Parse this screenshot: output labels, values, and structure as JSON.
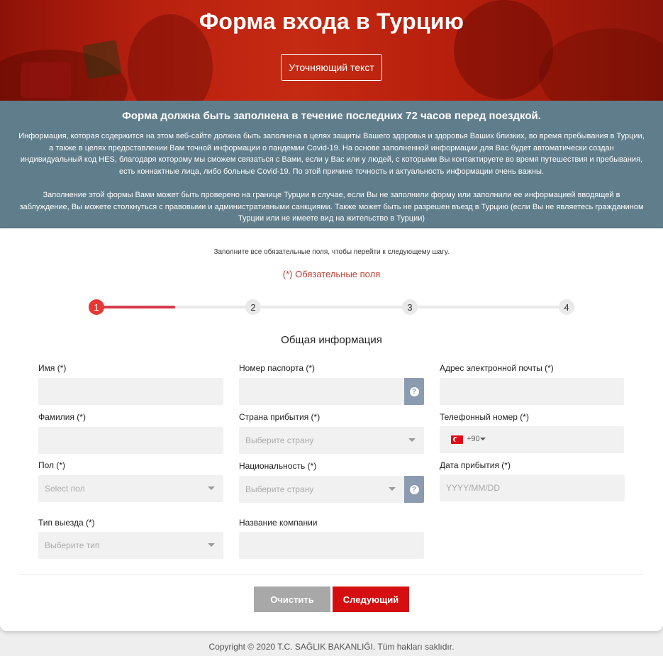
{
  "hero": {
    "title": "Форма входа в Турцию",
    "button_label": "Уточняющий текст"
  },
  "info": {
    "heading": "Форма должна быть заполнена в течение последних 72 часов перед поездкой.",
    "paragraph1": "Информация, которая содержится на этом веб-сайте должна быть заполнена в целях защиты Вашего здоровья и здоровья Ваших близких, во время пребывания в Турции, а также в целях предоставлении Вам точной информации о пандемии Covid-19. На основе заполненной информации для Вас будет автоматически создан индивидуальный код HES, благодаря которому мы сможем связаться с Вами, если у Вас или у людей, с которыми Вы контактируете во время путешествия и пребывания, есть коннактные лица, либо больные Covid-19. По этой причине точность и актуальность информации очень важны.",
    "paragraph2": "Заполнение этой формы Вами может быть проверено на границе Турции в случае, если Вы не заполнили форму или заполнили ее информацией вводящей в заблуждение, Вы можете столкнуться с правовыми и административными санкциями. Также может быть не разрешен въезд в Турцию (если Вы не являетесь гражданином Турции или не имеете вид на жительство в Турции)"
  },
  "form": {
    "instruction": "Заполните все обязательные поля, чтобы перейти к следующему шагу.",
    "required_note": "(*) Обязательные поля",
    "steps": [
      "1",
      "2",
      "3",
      "4"
    ],
    "active_step": 1,
    "section_title": "Общая информация",
    "fields": {
      "first_name": {
        "label": "Имя (*)",
        "value": ""
      },
      "last_name": {
        "label": "Фамилия (*)",
        "value": ""
      },
      "gender": {
        "label": "Пол (*)",
        "placeholder": "Select пол"
      },
      "exit_type": {
        "label": "Тип выезда (*)",
        "placeholder": "Выберите тип"
      },
      "passport": {
        "label": "Номер паспорта (*)",
        "value": ""
      },
      "arrival_country": {
        "label": "Страна прибытия (*)",
        "placeholder": "Выберите страну"
      },
      "nationality": {
        "label": "Национальность (*)",
        "placeholder": "Выберите страну"
      },
      "company": {
        "label": "Название компании",
        "value": ""
      },
      "email": {
        "label": "Адрес электронной почты (*)",
        "value": ""
      },
      "phone": {
        "label": "Телефонный номер (*)",
        "code": "+90"
      },
      "arrival_date": {
        "label": "Дата прибытия (*)",
        "placeholder": "YYYY/MM/DD"
      }
    },
    "help_symbol": "?",
    "buttons": {
      "clear": "Очистить",
      "next": "Следующий"
    }
  },
  "footer": {
    "copyright": "Copyright © 2020 T.C. SAĞLIK BAKANLIĞI. Tüm hakları saklıdır."
  },
  "colors": {
    "brand_red": "#d50f0f",
    "info_band": "#607d8b",
    "step_active": "#e53935",
    "help_button": "#8b9bb0"
  },
  "icons": {
    "help": "question-circle-icon",
    "dropdown": "chevron-down-icon",
    "flag": "turkey-flag-icon"
  }
}
